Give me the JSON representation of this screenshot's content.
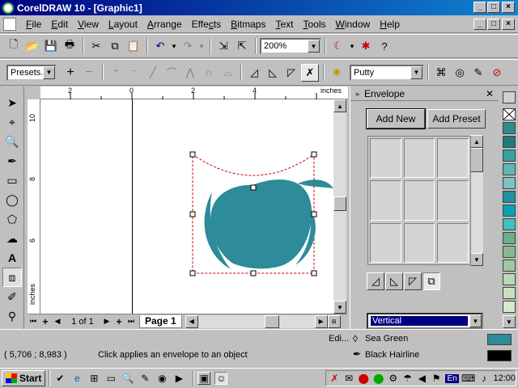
{
  "window": {
    "title": "CorelDRAW 10 - [Graphic1]"
  },
  "menu": [
    "File",
    "Edit",
    "View",
    "Layout",
    "Arrange",
    "Effects",
    "Bitmaps",
    "Text",
    "Tools",
    "Window",
    "Help"
  ],
  "menu_accel": [
    "F",
    "E",
    "V",
    "L",
    "A",
    "c",
    "B",
    "T",
    "T",
    "W",
    "H"
  ],
  "toolbar": {
    "zoom": "200%"
  },
  "propertybar": {
    "presets": "Presets...",
    "mapping_mode": "Putty"
  },
  "rulers": {
    "unit": "inches",
    "h_ticks": [
      "2",
      "0",
      "2",
      "4"
    ],
    "v_ticks": [
      "10",
      "8",
      "6"
    ]
  },
  "pages": {
    "count": "1 of 1",
    "tab": "Page 1"
  },
  "docker": {
    "title": "Envelope",
    "add_new": "Add New",
    "add_preset": "Add Preset",
    "mode": "Vertical"
  },
  "status": {
    "coords": "( 5,706 ; 8,983 )",
    "hint": "Click applies an envelope to an object",
    "fill_label": "Edi...",
    "fill_name": "Sea Green",
    "outline_name": "Black  Hairline"
  },
  "colors": {
    "sea_green": "#2e8b99",
    "selection": "#cc0000",
    "title_start": "#000080",
    "title_end": "#1084d0"
  },
  "palette": [
    "#ffffff",
    "#2e8b8b",
    "#1e7b7b",
    "#3aa0a0",
    "#5fb6b6",
    "#7cc4c4",
    "#1e90a0",
    "#0aa0b8",
    "#40c0c0",
    "#6ab08a",
    "#8ab890",
    "#a0c8a0",
    "#b8d8b8",
    "#c8e0c0",
    "#d8e8d0"
  ],
  "taskbar": {
    "start": "Start",
    "clock": "12:00",
    "lang": "En"
  }
}
